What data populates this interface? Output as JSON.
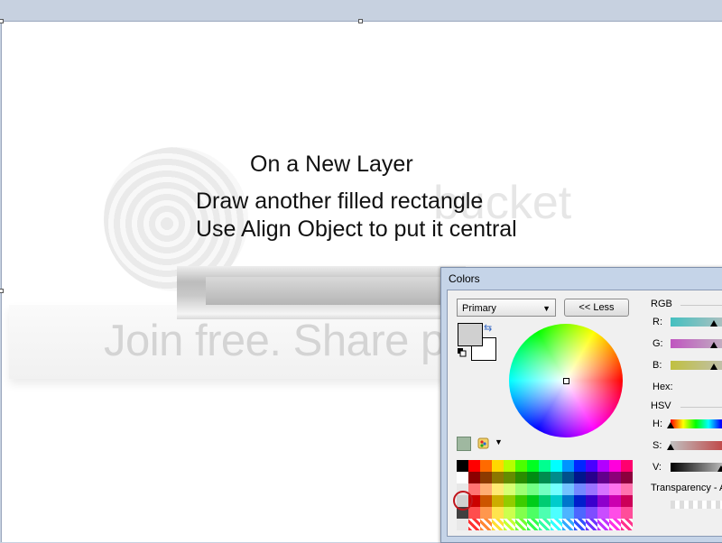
{
  "instructions": {
    "line1": "On a New Layer",
    "line2": "Draw another filled rectangle",
    "line3": "Use Align Object to put it central"
  },
  "watermark": {
    "tagline": "Join free. Share privately.",
    "brand": "bucket"
  },
  "colors_dialog": {
    "title": "Colors",
    "mode_select": "Primary",
    "less_button": "<< Less",
    "rgb_section": "RGB",
    "r_label": "R:",
    "g_label": "G:",
    "b_label": "B:",
    "hex_label": "Hex:",
    "hsv_section": "HSV",
    "h_label": "H:",
    "s_label": "S:",
    "v_label": "V:",
    "transparency_label": "Transparency - A",
    "primary_color": "#d0d0d0",
    "secondary_color": "#ffffff"
  },
  "icons": {
    "swap": "swap-colors-icon",
    "reset": "reset-colors-icon",
    "add": "add-color-icon",
    "palette": "palette-menu-icon",
    "dropdown": "chevron-down-icon"
  }
}
